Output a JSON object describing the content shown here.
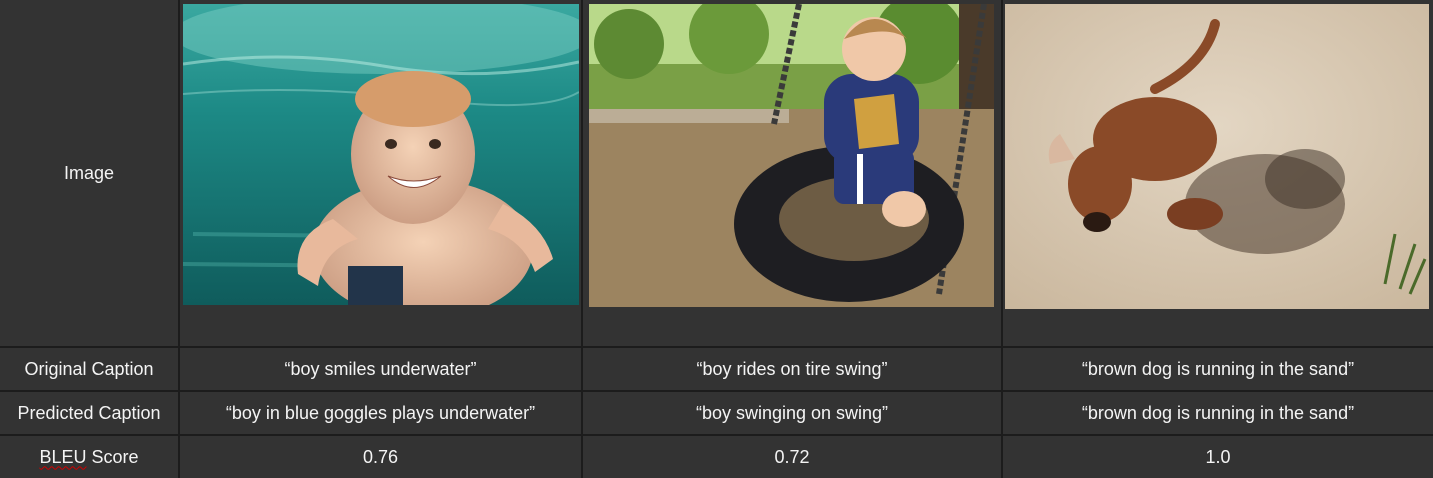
{
  "row_labels": {
    "image": "Image",
    "original": "Original Caption",
    "predicted": "Predicted Caption",
    "bleu_word": "BLEU",
    "bleu_rest": " Score"
  },
  "columns": [
    {
      "image_subject": "boy underwater in pool",
      "original_caption": "“boy smiles underwater”",
      "predicted_caption": "“boy in blue goggles plays underwater”",
      "bleu": "0.76"
    },
    {
      "image_subject": "boy on tire swing",
      "original_caption": "“boy rides on tire swing”",
      "predicted_caption": "“boy swinging on swing”",
      "bleu": "0.72"
    },
    {
      "image_subject": "brown dog running in sand",
      "original_caption": "“brown dog is running in the sand”",
      "predicted_caption": "“brown dog is running in the sand”",
      "bleu": "1.0"
    }
  ],
  "colors": {
    "cell_bg": "#333333",
    "grid_line": "#1c1c1c",
    "text": "#f4f4f4",
    "spellcheck": "#d00000"
  }
}
